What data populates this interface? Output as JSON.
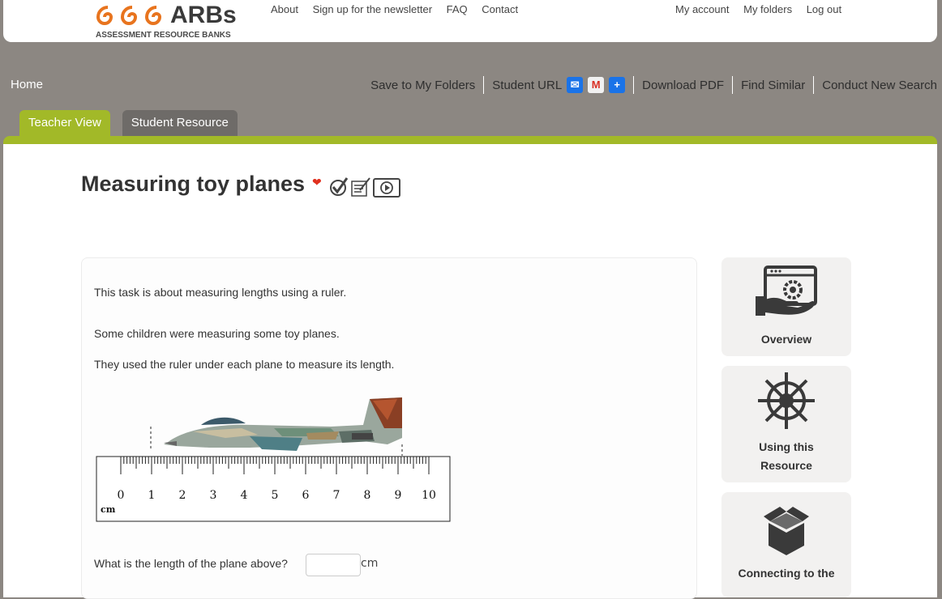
{
  "logo": {
    "text": "ARBs",
    "subtitle": "ASSESSMENT RESOURCE BANKS"
  },
  "topnav_left": [
    "About",
    "Sign up for the newsletter",
    "FAQ",
    "Contact"
  ],
  "topnav_right": [
    "My account",
    "My folders",
    "Log out"
  ],
  "home": "Home",
  "actions": {
    "save": "Save to My Folders",
    "student_url": "Student URL",
    "download": "Download PDF",
    "find_similar": "Find Similar",
    "new_search": "Conduct New Search"
  },
  "tabs": [
    "Teacher View",
    "Student Resource"
  ],
  "resource": {
    "title": "Measuring toy planes",
    "intro": "This task is about measuring lengths using a ruler.",
    "p1": "Some children were measuring some toy planes.",
    "p2": "They used the ruler under each plane to measure its length.",
    "question": "What is the length of the plane above?",
    "unit": "cm",
    "answer": ""
  },
  "ruler": {
    "numbers": [
      "0",
      "1",
      "2",
      "3",
      "4",
      "5",
      "6",
      "7",
      "8",
      "9",
      "10"
    ],
    "unit_label": "cm"
  },
  "sidebar": {
    "overview": "Overview",
    "using_line1": "Using this",
    "using_line2": "Resource",
    "connecting": "Connecting to the"
  },
  "colors": {
    "accent_green": "#a2b928",
    "header_grey": "#8c8782",
    "tab_grey": "#6e6b68",
    "logo_orange": "#e8741e"
  }
}
